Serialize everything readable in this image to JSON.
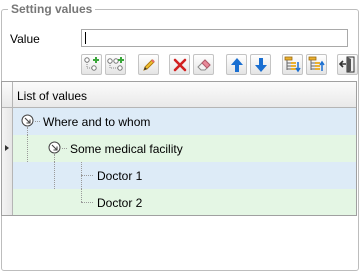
{
  "group": {
    "title": "Setting values"
  },
  "value_field": {
    "label": "Value",
    "value": ""
  },
  "toolbar": {
    "buttons": [
      {
        "name": "add-child-node-button",
        "icon": "add-child-node-icon"
      },
      {
        "name": "add-sibling-node-button",
        "icon": "add-sibling-node-icon"
      },
      {
        "name": "edit-button",
        "icon": "pencil-icon"
      },
      {
        "name": "delete-button",
        "icon": "red-x-icon"
      },
      {
        "name": "clear-button",
        "icon": "eraser-icon"
      },
      {
        "name": "move-up-button",
        "icon": "arrow-up-icon"
      },
      {
        "name": "move-down-button",
        "icon": "arrow-down-icon"
      },
      {
        "name": "expand-all-button",
        "icon": "tree-expand-icon"
      },
      {
        "name": "collapse-all-button",
        "icon": "tree-collapse-icon"
      },
      {
        "name": "exit-button",
        "icon": "exit-door-icon"
      }
    ]
  },
  "grid": {
    "column_header": "List of values",
    "rows": [
      {
        "label": "Where and to whom",
        "level": 0,
        "expanded": true
      },
      {
        "label": "Some medical facility",
        "level": 1,
        "expanded": true,
        "current": true
      },
      {
        "label": "Doctor 1",
        "level": 2
      },
      {
        "label": "Doctor 2",
        "level": 2
      }
    ]
  },
  "colors": {
    "row_blue": "#ddebf7",
    "row_green": "#e4f6e4",
    "toolbar_arrow_blue": "#1a6fd1",
    "delete_red": "#d11f1f",
    "add_green": "#3aa63a"
  }
}
